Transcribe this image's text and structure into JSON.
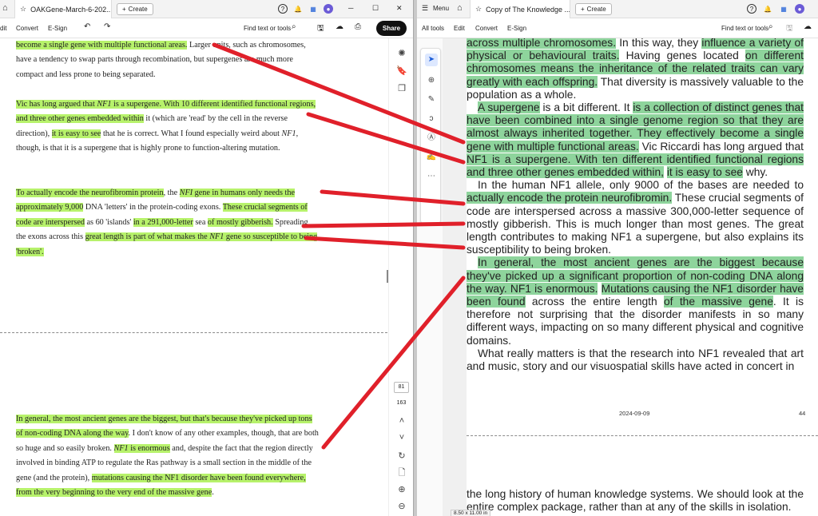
{
  "left": {
    "tab_title": "OAKGene-March-6-202...",
    "create_label": "Create",
    "menu": [
      "dit",
      "Convert",
      "E-Sign"
    ],
    "find_label": "Find text or tools",
    "share_label": "Share",
    "page_current": "81",
    "page_total": "163",
    "paragraphs": {
      "p1": [
        {
          "t": "become a single gene with multiple functional areas.",
          "h": true
        },
        {
          "t": " Larger units, such as chromosomes, have a tendency to swap parts through recombination, but supergenes are much more compact and less prone to being separated.",
          "h": false
        }
      ],
      "p2": [
        {
          "t": "Vic has long argued that ",
          "h": true
        },
        {
          "t": "NF1",
          "h": true,
          "i": true
        },
        {
          "t": " is a supergene. With 10 different identified functional regions, and three other genes embedded within",
          "h": true
        },
        {
          "t": " it (which are 'read' by the cell in the reverse direction), ",
          "h": false
        },
        {
          "t": "it is easy to see",
          "h": true
        },
        {
          "t": " that he is correct. What I found especially weird about ",
          "h": false
        },
        {
          "t": "NF1",
          "h": false,
          "i": true
        },
        {
          "t": ", though, is that it is a supergene that is highly prone to function-altering mutation.",
          "h": false
        }
      ],
      "p3": [
        {
          "t": "To actually encode the neurofibromin protein",
          "h": true
        },
        {
          "t": ", the ",
          "h": false
        },
        {
          "t": "NFI",
          "h": true,
          "i": true
        },
        {
          "t": " gene in humans only needs the approximately 9,000",
          "h": true
        },
        {
          "t": " DNA 'letters' in the protein-coding exons. ",
          "h": false
        },
        {
          "t": "These crucial segments of code are interspersed",
          "h": true
        },
        {
          "t": " as 60 'islands' ",
          "h": false
        },
        {
          "t": "in a 291,000-letter",
          "h": true
        },
        {
          "t": " sea ",
          "h": false
        },
        {
          "t": "of mostly gibberish.",
          "h": true
        },
        {
          "t": " Spreading the exons across this ",
          "h": false
        },
        {
          "t": "great length is part of what makes the ",
          "h": true
        },
        {
          "t": "NF1",
          "h": true,
          "i": true
        },
        {
          "t": " gene so susceptible to being 'broken'.",
          "h": true
        }
      ],
      "p4": [
        {
          "t": "In general, the most ancient genes are the biggest, but that's because they've picked up tons of non-coding DNA along the way",
          "h": true
        },
        {
          "t": ". I don't know of any other examples, though, that are both so huge and so easily broken. ",
          "h": false
        },
        {
          "t": "NF1",
          "h": true,
          "i": true
        },
        {
          "t": " is enormous",
          "h": true
        },
        {
          "t": " and, despite the fact that the region directly involved in binding ATP to regulate the Ras pathway is a small section in the middle of the gene (and the protein), ",
          "h": false
        },
        {
          "t": "mutations causing the NF1 disorder have been found everywhere, from the very beginning to the very end of the massive gene",
          "h": true
        },
        {
          "t": ".",
          "h": false
        }
      ]
    }
  },
  "right": {
    "menu_label": "Menu",
    "tab_title": "Copy of The Knowledge ...",
    "create_label": "Create",
    "toolbar": [
      "All tools",
      "Edit",
      "Convert",
      "E-Sign"
    ],
    "find_label": "Find text or tools",
    "footer_date": "2024-09-09",
    "footer_page": "44",
    "page_size": "8.50 x 11.00 in",
    "paragraphs": {
      "r1": [
        {
          "t": "across multiple chromosomes.",
          "h": true
        },
        {
          "t": " In this way, they ",
          "h": false
        },
        {
          "t": "influence a variety of physical or behavioural traits.",
          "h": true
        },
        {
          "t": " Having genes located ",
          "h": false
        },
        {
          "t": "on different chromosomes",
          "h": true
        },
        {
          "t": " means the inheritance of the related traits can vary greatly with each offspring.",
          "h": true
        },
        {
          "t": " That diversity is massively valuable to the population as a whole.",
          "h": false
        }
      ],
      "r2": [
        {
          "t": "A supergene",
          "h": true
        },
        {
          "t": " is a bit different. It ",
          "h": false
        },
        {
          "t": "is a collection of distinct genes that have been combined into a single genome region so that they are almost always inherited together. They effectively become a single gene with multiple functional areas.",
          "h": true
        },
        {
          "t": " Vic Riccardi has long argued that ",
          "h": false
        },
        {
          "t": "NF1 is a supergene. With ten different identified functional regions and three other genes embedded within,",
          "h": true
        },
        {
          "t": " ",
          "h": false
        },
        {
          "t": "it is easy to see",
          "h": true
        },
        {
          "t": " why.",
          "h": false
        }
      ],
      "r3": [
        {
          "t": "In the human NF1 allele, only 9000 of the bases are needed to ",
          "h": false
        },
        {
          "t": "actually encode the protein neurofibromin.",
          "h": true
        },
        {
          "t": " These crucial segments of code are interspersed across a massive 300,000-letter sequence of mostly gibberish.",
          "h": false
        },
        {
          "t": " This is much longer than most genes. The great length contributes to making NF1 a supergene, but also explains its susceptibility to being broken.",
          "h": false
        }
      ],
      "r4": [
        {
          "t": "In general, the most ancient genes are the biggest because they've picked up a significant proportion of non-coding DNA along the way. NF1 is enormous.",
          "h": true
        },
        {
          "t": " ",
          "h": false
        },
        {
          "t": "Mutations causing the NF1 disorder have been found",
          "h": true
        },
        {
          "t": " across the entire length ",
          "h": false
        },
        {
          "t": "of the massive gene",
          "h": true
        },
        {
          "t": ". It is therefore not surprising that the disorder manifests in so many different ways, impacting on so many different physical and cognitive domains.",
          "h": false
        }
      ],
      "r5": [
        {
          "t": "What really matters is that the research into NF1 revealed that art and music, story and our visuospatial skills have acted in concert in",
          "h": false
        }
      ],
      "r6": [
        {
          "t": "the long history of human knowledge systems. We should look at the entire complex package, rather than at any of the skills in isolation.",
          "h": false
        }
      ]
    }
  },
  "colors": {
    "left_highlight": "#b7f26b",
    "right_highlight": "#8ed49c",
    "arrow": "#e0202a"
  }
}
